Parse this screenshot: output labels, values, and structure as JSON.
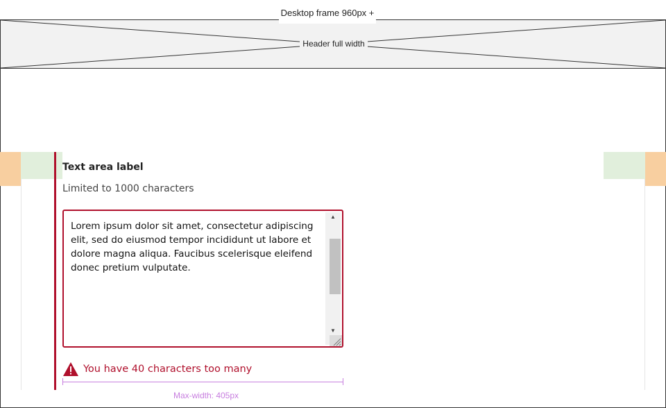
{
  "frame": {
    "label": "Desktop frame 960px +"
  },
  "header": {
    "label": "Header full width"
  },
  "field": {
    "label": "Text area label",
    "hint": "Limited to 1000 characters",
    "value": "Lorem ipsum dolor sit amet, consectetur adipiscing\nelit, sed do eiusmod tempor incididunt ut labore et\ndolore magna aliqua. Faucibus scelerisque eleifend\ndonec pretium vulputate.",
    "error": "You have 40 characters too many"
  },
  "annotation": {
    "max_width": "Max-width: 405px"
  },
  "colors": {
    "error": "#b0102c",
    "margin": "#f8cfa0",
    "gutter": "#e1efdc",
    "annotation": "#c77ddf",
    "header_bg": "#f2f2f2"
  },
  "icons": [
    "warning-icon",
    "scroll-up-icon",
    "scroll-down-icon",
    "resize-handle-icon"
  ]
}
